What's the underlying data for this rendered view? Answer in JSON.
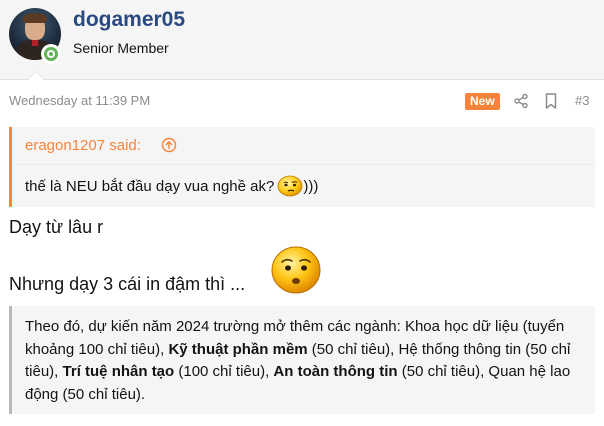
{
  "user": {
    "name": "dogamer05",
    "title": "Senior Member"
  },
  "post": {
    "date": "Wednesday at 11:39 PM",
    "badge": "New",
    "number": "#3"
  },
  "quote": {
    "author": "eragon1207 said:",
    "text": "thế là NEU bắt đầu dạy vua nghề ak?",
    "suffix": ")))"
  },
  "message": {
    "line1": "Dạy từ lâu r",
    "line2": "Nhưng dạy 3 cái in đậm thì ..."
  },
  "info": {
    "seg1": "Theo đó, dự kiến năm 2024 trường mở thêm các ngành: Khoa học dữ liệu (tuyển khoảng 100 chỉ tiêu), ",
    "bold1": "Kỹ thuật phần mềm",
    "seg2": " (50 chỉ tiêu), Hệ thống thông tin (50 chỉ tiêu), ",
    "bold2": "Trí tuệ nhân tạo",
    "seg3": " (100 chỉ tiêu), ",
    "bold3": "An toàn thông tin",
    "seg4": " (50 chỉ tiêu), Quan hệ lao động (50 chỉ tiêu)."
  },
  "icons": {
    "share": "share-icon",
    "bookmark": "bookmark-icon",
    "quote_link": "arrow-up-circle-icon",
    "emoji_thinking": "thinking-smiley-icon",
    "emoji_sad": "worried-smiley-icon"
  },
  "colors": {
    "accent": "#f7843a",
    "username": "#2a4a7f",
    "online": "#63b359",
    "muted": "#8c8c8c"
  }
}
